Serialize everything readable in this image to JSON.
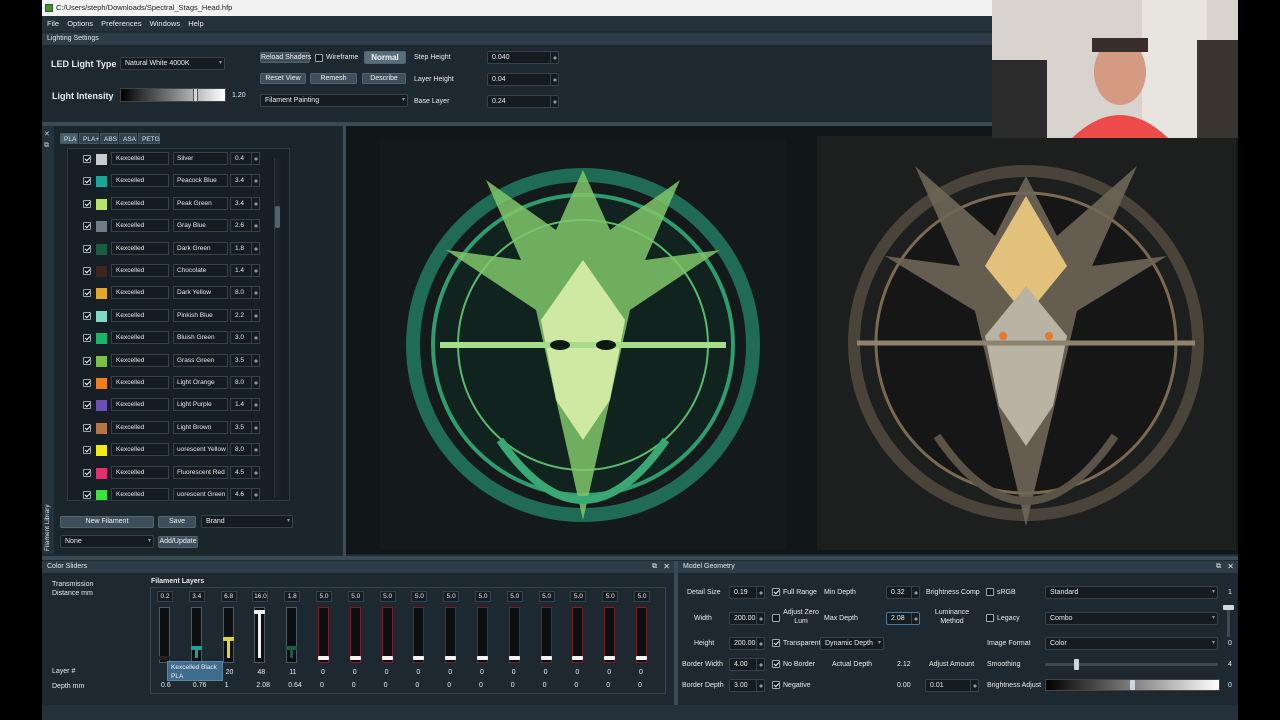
{
  "window": {
    "title": "C:/Users/steph/Downloads/Spectral_Stags_Head.hfp"
  },
  "menu": [
    "File",
    "Options",
    "Preferences",
    "Windows",
    "Help"
  ],
  "lighting": {
    "header": "Lighting Settings",
    "led_type_label": "LED Light Type",
    "led_type_value": "Natural White 4000K",
    "intensity_label": "Light Intensity",
    "intensity_value": "1.20",
    "intensity_level": 0.72,
    "reload_shaders": "Reload Shaders",
    "wireframe": "Wireframe",
    "normal": "Normal",
    "reset_view": "Reset View",
    "remesh": "Remesh",
    "describe": "Describe",
    "mode_value": "Filament Painting",
    "step_height_label": "Step Height",
    "step_height_value": "0.040",
    "layer_height_label": "Layer Height",
    "layer_height_value": "0.04",
    "base_layer_label": "Base Layer",
    "base_layer_value": "0.24"
  },
  "library": {
    "side_title": "Filament Library",
    "tabs": [
      "PLA",
      "PLA+",
      "ABS",
      "ASA",
      "PETG"
    ],
    "rows": [
      {
        "brand": "Kexcelled",
        "name": "Silver",
        "td": "0.4",
        "color": "#c9cccd"
      },
      {
        "brand": "Kexcelled",
        "name": "Peacock Blue",
        "td": "3.4",
        "color": "#1aa59b"
      },
      {
        "brand": "Kexcelled",
        "name": "Peak Green",
        "td": "3.4",
        "color": "#b7e36b"
      },
      {
        "brand": "Kexcelled",
        "name": "Gray Blue",
        "td": "2.6",
        "color": "#6e7d87"
      },
      {
        "brand": "Kexcelled",
        "name": "Dark Green",
        "td": "1.8",
        "color": "#1e5a40"
      },
      {
        "brand": "Kexcelled",
        "name": "Chocolate",
        "td": "1.4",
        "color": "#3c2420"
      },
      {
        "brand": "Kexcelled",
        "name": "Dark Yellow",
        "td": "8.0",
        "color": "#e3a72a"
      },
      {
        "brand": "Kexcelled",
        "name": "Pinkish Blue",
        "td": "2.2",
        "color": "#7fd9c7"
      },
      {
        "brand": "Kexcelled",
        "name": "Bluish Green",
        "td": "3.0",
        "color": "#1db36b"
      },
      {
        "brand": "Kexcelled",
        "name": "Grass Green",
        "td": "3.5",
        "color": "#7dc142"
      },
      {
        "brand": "Kexcelled",
        "name": "Light Orange",
        "td": "8.0",
        "color": "#f07f19"
      },
      {
        "brand": "Kexcelled",
        "name": "Light Purple",
        "td": "1.4",
        "color": "#6a4fb6"
      },
      {
        "brand": "Kexcelled",
        "name": "Light Brown",
        "td": "3.5",
        "color": "#b57743"
      },
      {
        "brand": "Kexcelled",
        "name": "uorescent Yellow",
        "td": "8.0",
        "color": "#f1ea1b"
      },
      {
        "brand": "Kexcelled",
        "name": "Fluorescent Red",
        "td": "4.5",
        "color": "#e2306e"
      },
      {
        "brand": "Kexcelled",
        "name": "uorescent Green",
        "td": "4.6",
        "color": "#3fe33f"
      }
    ],
    "new_filament": "New Filament",
    "save": "Save",
    "brand_placeholder": "Brand",
    "none_value": "None",
    "add_update": "Add/Update"
  },
  "color_sliders": {
    "header": "Color Sliders",
    "transmission_label": "Transmission Distance mm",
    "layers_label": "Filament Layers",
    "layer_label": "Layer #",
    "depth_label": "Depth mm",
    "tooltip_line1": "Kexcelled Black",
    "tooltip_line2": "PLA",
    "tvalues": [
      "0.2",
      "3.4",
      "6.8",
      "16.0",
      "1.8",
      "5.0",
      "5.0",
      "5.0",
      "5.0",
      "5.0",
      "5.0",
      "5.0",
      "5.0",
      "5.0",
      "5.0",
      "5.0"
    ],
    "layer_nums": [
      "",
      "",
      "20",
      "48",
      "11",
      "0",
      "0",
      "0",
      "0",
      "0",
      "0",
      "0",
      "0",
      "0",
      "0",
      "0"
    ],
    "depths": [
      "0.6",
      "0.76",
      "1",
      "2.08",
      "0.64",
      "0",
      "0",
      "0",
      "0",
      "0",
      "0",
      "0",
      "0",
      "0",
      "0",
      "0"
    ],
    "levels": [
      0.0,
      0.2,
      0.4,
      0.95,
      0.2,
      0.0,
      0.0,
      0.0,
      0.0,
      0.0,
      0.0,
      0.0,
      0.0,
      0.0,
      0.0,
      0.0
    ],
    "fill_colors": [
      "#111111",
      "#1aa59b",
      "#e3d22a",
      "#f0f0f0",
      "#1e5a40",
      "",
      "",
      "",
      "",
      "",
      "",
      "",
      "",
      "",
      "",
      ""
    ]
  },
  "model_geometry": {
    "header": "Model Geometry",
    "detail_size_label": "Detail Size",
    "detail_size_value": "0.19",
    "full_range": "Full Range",
    "min_depth_label": "Min Depth",
    "min_depth_value": "0.32",
    "brightness_comp_label": "Brightness Comp",
    "srgb": "sRGB",
    "standard_value": "Standard",
    "standard_num": "1",
    "width_label": "Width",
    "width_value": "200.00",
    "adjust_zero_lum": "Adjust Zero Lum",
    "max_depth_label": "Max Depth",
    "max_depth_value": "2.08",
    "luminance_method_label": "Luminance Method",
    "legacy": "Legacy",
    "combo_value": "Combo",
    "height_label": "Height",
    "height_value": "200.00",
    "transparent": "Transparent",
    "dynamic_depth_value": "Dynamic Depth",
    "image_format_label": "Image Format",
    "color_value": "Color",
    "image_format_num": "0",
    "border_width_label": "Border Width",
    "border_width_value": "4.00",
    "no_border": "No Border",
    "actual_depth_label": "Actual Depth",
    "actual_depth_value": "2.12",
    "adjust_amount_label": "Adjust Amount",
    "smoothing_label": "Smoothing",
    "smoothing_num": "4",
    "smoothing_level": 0.17,
    "border_depth_label": "Border Depth",
    "border_depth_value": "3.00",
    "negative": "Negative",
    "zero_value": "0.00",
    "adjust_value": "0.01",
    "brightness_adjust_label": "Brightness Adjust",
    "brightness_adjust_num": "0",
    "brightness_level": 0.5
  }
}
